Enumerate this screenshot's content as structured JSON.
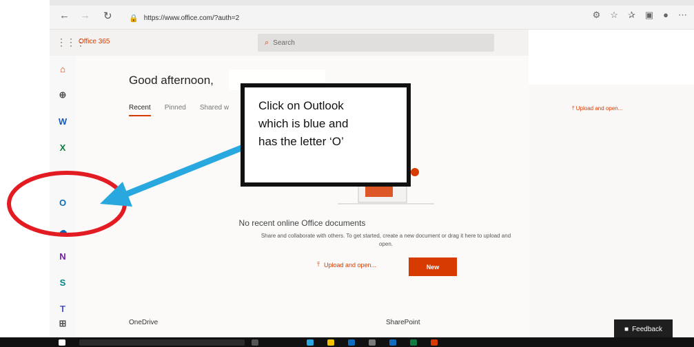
{
  "browser": {
    "url": "https://www.office.com/?auth=2",
    "back_icon": "arrow-left-icon",
    "forward_icon": "arrow-right-icon",
    "refresh_icon": "refresh-icon"
  },
  "app": {
    "name": "Office 365",
    "search_placeholder": "Search"
  },
  "main": {
    "greeting": "Good afternoon,",
    "tabs": [
      {
        "label": "Recent"
      },
      {
        "label": "Pinned"
      },
      {
        "label": "Shared w"
      }
    ],
    "empty_title": "No recent online Office documents",
    "empty_subtitle": "Share and collaborate with others. To get started, create a new document or drag it here to upload and open.",
    "upload_label": "Upload and open...",
    "new_label": "New",
    "sections": {
      "onedrive": "OneDrive",
      "sharepoint": "SharePoint"
    }
  },
  "right": {
    "upload_label": "Upload and open..."
  },
  "callout": {
    "lines": [
      "Click on Outlook",
      "which is blue and",
      "has the letter ‘O’"
    ]
  },
  "feedback": {
    "label": "Feedback"
  },
  "colors": {
    "brand": "#d83b01",
    "annotation_blue": "#29a8e0",
    "annotation_red": "#e31b23"
  }
}
